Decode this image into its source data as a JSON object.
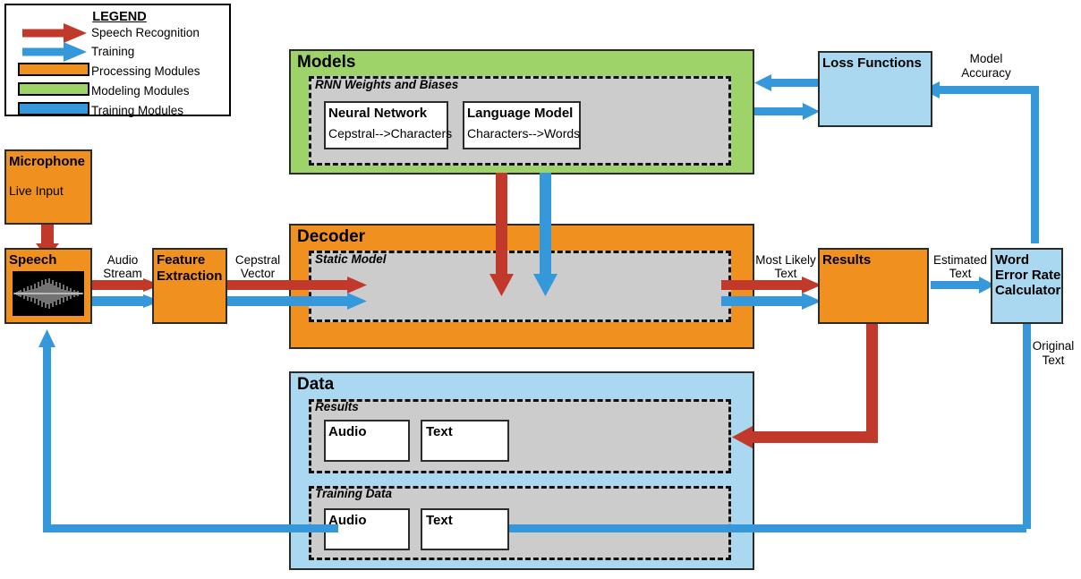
{
  "legend": {
    "title": "LEGEND",
    "arrow_items": [
      {
        "label": "Speech Recognition",
        "color": "#c0392b"
      },
      {
        "label": "Training",
        "color": "#3498db"
      }
    ],
    "swatch_items": [
      {
        "label": "Processing Modules",
        "color": "#f0901f"
      },
      {
        "label": "Modeling Modules",
        "color": "#9ed36a"
      },
      {
        "label": "Training Modules",
        "color": "#3498db"
      }
    ]
  },
  "colors": {
    "speech_recognition": "#c0392b",
    "training": "#3498db",
    "processing": "#f0901f",
    "modeling": "#9ed36a",
    "training_module": "#a9d8f0",
    "inner_panel": "#cccccc",
    "outline": "#2b2b2b"
  },
  "groups": {
    "models": {
      "title": "Models",
      "panel_title": "RNN Weights and Biases",
      "boxes": [
        {
          "title": "Neural Network",
          "text": "Cepstral-->Characters"
        },
        {
          "title": "Language Model",
          "text": "Characters-->Words"
        }
      ]
    },
    "decoder": {
      "title": "Decoder",
      "panel_title": "Static Model"
    },
    "data": {
      "title": "Data",
      "panels": [
        {
          "title": "Results",
          "boxes": [
            {
              "title": "Audio"
            },
            {
              "title": "Text"
            }
          ]
        },
        {
          "title": "Training Data",
          "boxes": [
            {
              "title": "Audio"
            },
            {
              "title": "Text"
            }
          ]
        }
      ]
    }
  },
  "modules": {
    "microphone": {
      "title": "Microphone",
      "text": "Live Input"
    },
    "speech": {
      "title": "Speech"
    },
    "feature_extraction": {
      "title": "Feature",
      "title2": "Extraction"
    },
    "results": {
      "title": "Results"
    },
    "loss_functions": {
      "title": "Loss Functions"
    },
    "wer": {
      "title": "Word",
      "title2": "Error Rate",
      "title3": "Calculator"
    }
  },
  "edge_labels": {
    "audio_stream": "Audio\nStream",
    "audio_stream_l1": "Audio",
    "audio_stream_l2": "Stream",
    "cepstral_vector_l1": "Cepstral",
    "cepstral_vector_l2": "Vector",
    "most_likely_text_l1": "Most Likely",
    "most_likely_text_l2": "Text",
    "estimated_text_l1": "Estimated",
    "estimated_text_l2": "Text",
    "model_accuracy_l1": "Model",
    "model_accuracy_l2": "Accuracy",
    "original_text_l1": "Original",
    "original_text_l2": "Text"
  }
}
